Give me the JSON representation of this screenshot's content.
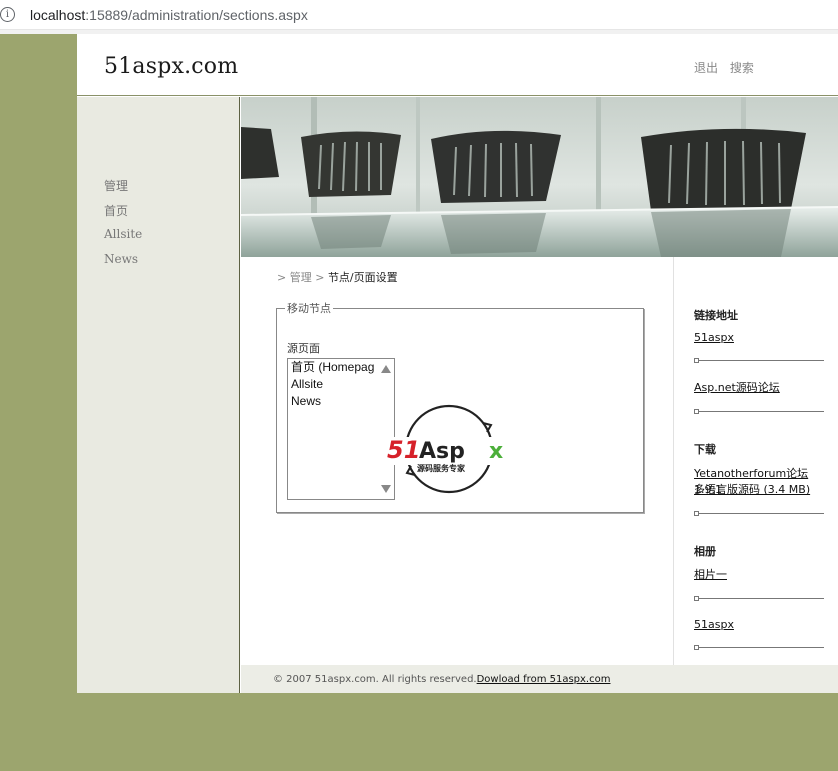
{
  "browser": {
    "url_host": "localhost",
    "url_rest": ":15889/administration/sections.aspx",
    "info_icon": "info-icon"
  },
  "header": {
    "logo": "51aspx.com",
    "links": [
      "退出",
      "搜索"
    ]
  },
  "sidebar": {
    "items": [
      "管理",
      "首页",
      "Allsite",
      "News"
    ]
  },
  "breadcrumb": {
    "sep": ">",
    "parent": "管理",
    "current": "节点/页面设置"
  },
  "move_section": {
    "legend": "移动节点",
    "source_label": "源页面",
    "options": [
      "首页 (Homepag",
      "Allsite",
      "News"
    ]
  },
  "watermark": {
    "brand_red": "51",
    "brand_black": "Asp",
    "brand_green": "x",
    "tagline": "源码服务专家"
  },
  "rightcol": {
    "links_title": "链接地址",
    "links": [
      "51aspx",
      "Asp.net源码论坛"
    ],
    "download_title": "下载",
    "download_line1": "Yetanotherforum论坛1.9.1",
    "download_line2": "多语言版源码 (3.4 MB)",
    "album_title": "相册",
    "album_links": [
      "相片一",
      "51aspx"
    ]
  },
  "footer": {
    "copyright": "© 2007 51aspx.com. All rights reserved.",
    "link": "Dowload from 51aspx.com"
  },
  "colors": {
    "background": "#9ca56e",
    "sidebar": "#e9eae1",
    "watermark_red": "#d6212a",
    "watermark_green": "#4caf3a"
  }
}
